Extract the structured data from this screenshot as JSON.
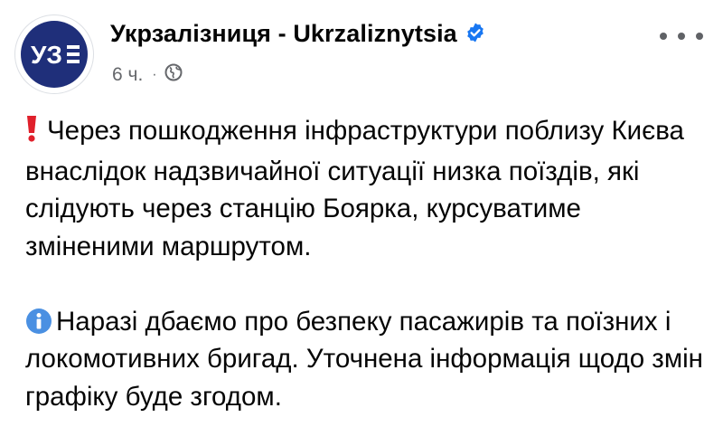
{
  "post": {
    "page_name": "Укрзалізниця - Ukrzaliznytsia",
    "avatar_text": "УЗ",
    "time": "6 ч.",
    "separator": "·",
    "icons": {
      "verified": "verified-badge-icon",
      "audience": "globe-icon",
      "more": "more-options-icon",
      "exclamation": "red-exclamation-icon",
      "info": "information-icon"
    },
    "paragraphs": [
      "Через пошкодження інфраструктури поблизу Києва внаслідок надзвичайної ситуації низка поїздів, які слідують через станцію Боярка, курсуватиме зміненими маршрутом.",
      "Наразі дбаємо про безпеку пасажирів та поїзних і локомотивних бригад. Уточнена інформація щодо змін графіку буде згодом."
    ]
  },
  "colors": {
    "verified": "#1877f2",
    "brand": "#1f2f7a",
    "meta_text": "#65676b",
    "exclamation": "#e0202b",
    "info": "#4a90e2"
  }
}
